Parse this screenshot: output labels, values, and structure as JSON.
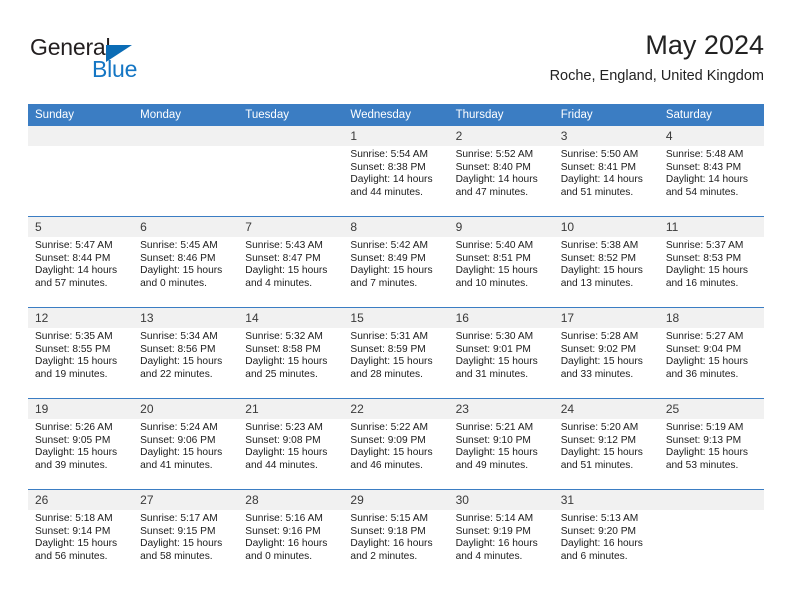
{
  "brand": {
    "name_part1": "General",
    "name_part2": "Blue",
    "triangle_color": "#0b6cb5",
    "blue_color": "#1476c4"
  },
  "header": {
    "title": "May 2024",
    "subtitle": "Roche, England, United Kingdom"
  },
  "theme": {
    "header_blue": "#3b7dc3",
    "daynum_band": "#f1f1f1",
    "text": "#1c1c1c"
  },
  "weekday_headers": [
    "Sunday",
    "Monday",
    "Tuesday",
    "Wednesday",
    "Thursday",
    "Friday",
    "Saturday"
  ],
  "weeks": [
    [
      {
        "day": "",
        "lines": []
      },
      {
        "day": "",
        "lines": []
      },
      {
        "day": "",
        "lines": []
      },
      {
        "day": "1",
        "lines": [
          "Sunrise: 5:54 AM",
          "Sunset: 8:38 PM",
          "Daylight: 14 hours",
          "and 44 minutes."
        ]
      },
      {
        "day": "2",
        "lines": [
          "Sunrise: 5:52 AM",
          "Sunset: 8:40 PM",
          "Daylight: 14 hours",
          "and 47 minutes."
        ]
      },
      {
        "day": "3",
        "lines": [
          "Sunrise: 5:50 AM",
          "Sunset: 8:41 PM",
          "Daylight: 14 hours",
          "and 51 minutes."
        ]
      },
      {
        "day": "4",
        "lines": [
          "Sunrise: 5:48 AM",
          "Sunset: 8:43 PM",
          "Daylight: 14 hours",
          "and 54 minutes."
        ]
      }
    ],
    [
      {
        "day": "5",
        "lines": [
          "Sunrise: 5:47 AM",
          "Sunset: 8:44 PM",
          "Daylight: 14 hours",
          "and 57 minutes."
        ]
      },
      {
        "day": "6",
        "lines": [
          "Sunrise: 5:45 AM",
          "Sunset: 8:46 PM",
          "Daylight: 15 hours",
          "and 0 minutes."
        ]
      },
      {
        "day": "7",
        "lines": [
          "Sunrise: 5:43 AM",
          "Sunset: 8:47 PM",
          "Daylight: 15 hours",
          "and 4 minutes."
        ]
      },
      {
        "day": "8",
        "lines": [
          "Sunrise: 5:42 AM",
          "Sunset: 8:49 PM",
          "Daylight: 15 hours",
          "and 7 minutes."
        ]
      },
      {
        "day": "9",
        "lines": [
          "Sunrise: 5:40 AM",
          "Sunset: 8:51 PM",
          "Daylight: 15 hours",
          "and 10 minutes."
        ]
      },
      {
        "day": "10",
        "lines": [
          "Sunrise: 5:38 AM",
          "Sunset: 8:52 PM",
          "Daylight: 15 hours",
          "and 13 minutes."
        ]
      },
      {
        "day": "11",
        "lines": [
          "Sunrise: 5:37 AM",
          "Sunset: 8:53 PM",
          "Daylight: 15 hours",
          "and 16 minutes."
        ]
      }
    ],
    [
      {
        "day": "12",
        "lines": [
          "Sunrise: 5:35 AM",
          "Sunset: 8:55 PM",
          "Daylight: 15 hours",
          "and 19 minutes."
        ]
      },
      {
        "day": "13",
        "lines": [
          "Sunrise: 5:34 AM",
          "Sunset: 8:56 PM",
          "Daylight: 15 hours",
          "and 22 minutes."
        ]
      },
      {
        "day": "14",
        "lines": [
          "Sunrise: 5:32 AM",
          "Sunset: 8:58 PM",
          "Daylight: 15 hours",
          "and 25 minutes."
        ]
      },
      {
        "day": "15",
        "lines": [
          "Sunrise: 5:31 AM",
          "Sunset: 8:59 PM",
          "Daylight: 15 hours",
          "and 28 minutes."
        ]
      },
      {
        "day": "16",
        "lines": [
          "Sunrise: 5:30 AM",
          "Sunset: 9:01 PM",
          "Daylight: 15 hours",
          "and 31 minutes."
        ]
      },
      {
        "day": "17",
        "lines": [
          "Sunrise: 5:28 AM",
          "Sunset: 9:02 PM",
          "Daylight: 15 hours",
          "and 33 minutes."
        ]
      },
      {
        "day": "18",
        "lines": [
          "Sunrise: 5:27 AM",
          "Sunset: 9:04 PM",
          "Daylight: 15 hours",
          "and 36 minutes."
        ]
      }
    ],
    [
      {
        "day": "19",
        "lines": [
          "Sunrise: 5:26 AM",
          "Sunset: 9:05 PM",
          "Daylight: 15 hours",
          "and 39 minutes."
        ]
      },
      {
        "day": "20",
        "lines": [
          "Sunrise: 5:24 AM",
          "Sunset: 9:06 PM",
          "Daylight: 15 hours",
          "and 41 minutes."
        ]
      },
      {
        "day": "21",
        "lines": [
          "Sunrise: 5:23 AM",
          "Sunset: 9:08 PM",
          "Daylight: 15 hours",
          "and 44 minutes."
        ]
      },
      {
        "day": "22",
        "lines": [
          "Sunrise: 5:22 AM",
          "Sunset: 9:09 PM",
          "Daylight: 15 hours",
          "and 46 minutes."
        ]
      },
      {
        "day": "23",
        "lines": [
          "Sunrise: 5:21 AM",
          "Sunset: 9:10 PM",
          "Daylight: 15 hours",
          "and 49 minutes."
        ]
      },
      {
        "day": "24",
        "lines": [
          "Sunrise: 5:20 AM",
          "Sunset: 9:12 PM",
          "Daylight: 15 hours",
          "and 51 minutes."
        ]
      },
      {
        "day": "25",
        "lines": [
          "Sunrise: 5:19 AM",
          "Sunset: 9:13 PM",
          "Daylight: 15 hours",
          "and 53 minutes."
        ]
      }
    ],
    [
      {
        "day": "26",
        "lines": [
          "Sunrise: 5:18 AM",
          "Sunset: 9:14 PM",
          "Daylight: 15 hours",
          "and 56 minutes."
        ]
      },
      {
        "day": "27",
        "lines": [
          "Sunrise: 5:17 AM",
          "Sunset: 9:15 PM",
          "Daylight: 15 hours",
          "and 58 minutes."
        ]
      },
      {
        "day": "28",
        "lines": [
          "Sunrise: 5:16 AM",
          "Sunset: 9:16 PM",
          "Daylight: 16 hours",
          "and 0 minutes."
        ]
      },
      {
        "day": "29",
        "lines": [
          "Sunrise: 5:15 AM",
          "Sunset: 9:18 PM",
          "Daylight: 16 hours",
          "and 2 minutes."
        ]
      },
      {
        "day": "30",
        "lines": [
          "Sunrise: 5:14 AM",
          "Sunset: 9:19 PM",
          "Daylight: 16 hours",
          "and 4 minutes."
        ]
      },
      {
        "day": "31",
        "lines": [
          "Sunrise: 5:13 AM",
          "Sunset: 9:20 PM",
          "Daylight: 16 hours",
          "and 6 minutes."
        ]
      },
      {
        "day": "",
        "lines": []
      }
    ]
  ]
}
